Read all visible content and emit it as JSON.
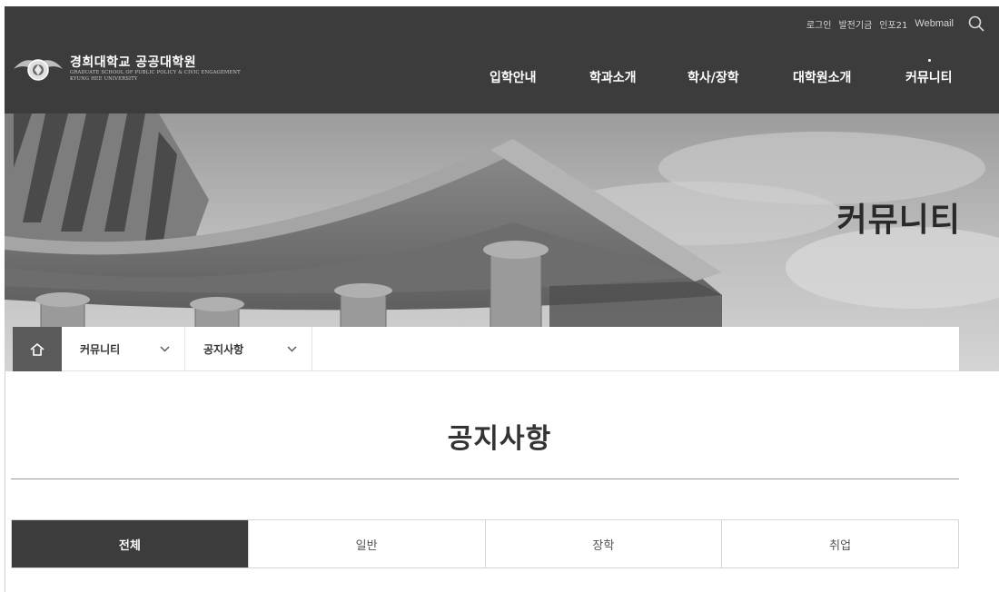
{
  "util_links": [
    "로그인",
    "발전기금",
    "인포21",
    "Webmail"
  ],
  "logo": {
    "title": "경희대학교 공공대학원",
    "sub1": "GRADUATE SCHOOL OF PUBLIC POLICY & CIVIC ENGAGEMENT",
    "sub2": "KYUNG HEE UNIVERSITY"
  },
  "nav": [
    "입학안내",
    "학과소개",
    "학사/장학",
    "대학원소개",
    "커뮤니티"
  ],
  "hero": {
    "title": "커뮤니티"
  },
  "breadcrumb": {
    "level1": "커뮤니티",
    "level2": "공지사항"
  },
  "page": {
    "title": "공지사항"
  },
  "tabs": [
    "전체",
    "일반",
    "장학",
    "취업"
  ],
  "active_tab": "전체",
  "icons": [
    "search-icon",
    "home-icon",
    "chevron-down-icon",
    "emblem-logo"
  ]
}
